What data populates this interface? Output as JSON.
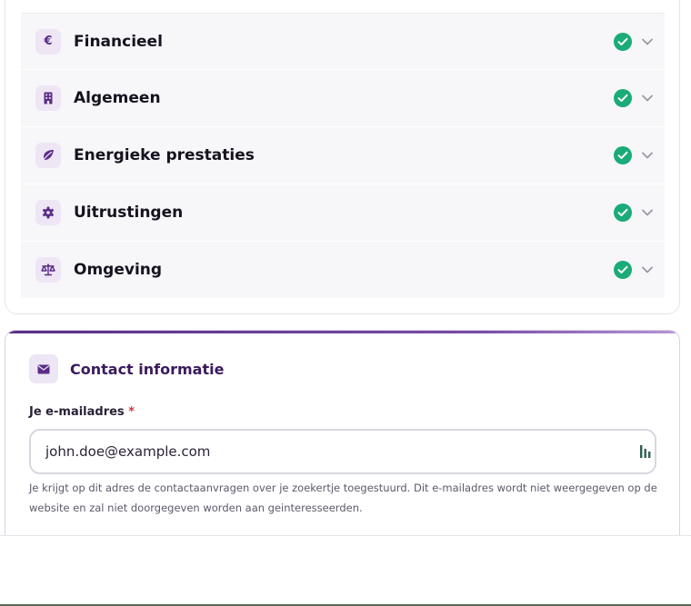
{
  "accordion": {
    "items": [
      {
        "label": "Financieel",
        "icon": "euro-icon",
        "glyph": "€",
        "status": "complete"
      },
      {
        "label": "Algemeen",
        "icon": "building-icon",
        "status": "complete"
      },
      {
        "label": "Energieke prestaties",
        "icon": "leaf-icon",
        "status": "complete"
      },
      {
        "label": "Uitrustingen",
        "icon": "gear-icon",
        "status": "complete"
      },
      {
        "label": "Omgeving",
        "icon": "scale-icon",
        "status": "complete"
      }
    ]
  },
  "contact": {
    "title": "Contact informatie",
    "email_label": "Je e-mailadres",
    "required_mark": "*",
    "email_value": "john.doe@example.com",
    "help_text": "Je krijgt op dit adres de contactaanvragen over je zoekertje toegestuurd. Dit e-mailadres wordt niet weergegeven op de website en zal niet doorgegeven worden aan geinteresseerden."
  },
  "colors": {
    "accent": "#5b2d87",
    "success": "#1aab78",
    "icon_bg": "#eee6f5"
  }
}
